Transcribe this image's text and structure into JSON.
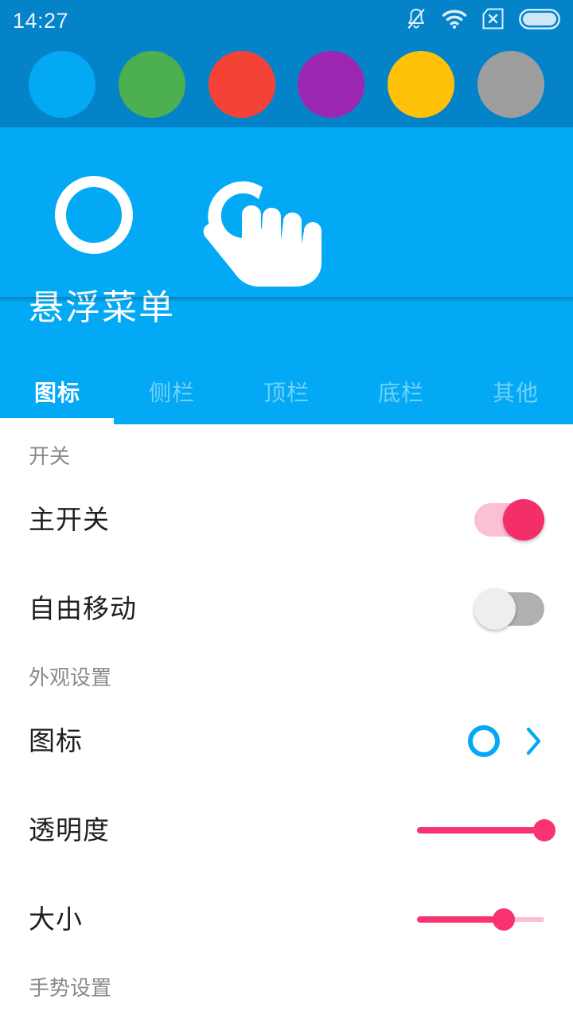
{
  "status_bar": {
    "time": "14:27",
    "icons": [
      {
        "name": "bell-muted-icon"
      },
      {
        "name": "wifi-icon"
      },
      {
        "name": "sim-disabled-icon"
      },
      {
        "name": "battery-icon"
      }
    ]
  },
  "color_palette": {
    "name": "color-swatch-strip",
    "background": "#0583c9",
    "swatches": [
      {
        "name": "swatch-blue",
        "color": "#03a9f4"
      },
      {
        "name": "swatch-green",
        "color": "#4caf50"
      },
      {
        "name": "swatch-red",
        "color": "#f44336"
      },
      {
        "name": "swatch-purple",
        "color": "#9c27b0"
      },
      {
        "name": "swatch-yellow",
        "color": "#ffc107"
      },
      {
        "name": "swatch-gray",
        "color": "#9e9e9e"
      }
    ]
  },
  "header": {
    "background": "#03a9f4",
    "title": "悬浮菜单",
    "art": {
      "ring_icon": "circle-ring-icon",
      "gesture_icon": "tap-gesture-hand-icon"
    }
  },
  "tabs": {
    "active_index": 0,
    "items": [
      {
        "label": "图标"
      },
      {
        "label": "侧栏"
      },
      {
        "label": "顶栏"
      },
      {
        "label": "底栏"
      },
      {
        "label": "其他"
      }
    ]
  },
  "sections": [
    {
      "title": "开关",
      "rows": [
        {
          "label": "主开关",
          "control": "toggle",
          "state": "on"
        },
        {
          "label": "自由移动",
          "control": "toggle",
          "state": "off"
        }
      ]
    },
    {
      "title": "外观设置",
      "rows": [
        {
          "label": "图标",
          "control": "chevron",
          "preview": "circle-ring-icon"
        },
        {
          "label": "透明度",
          "control": "slider",
          "value": 100
        },
        {
          "label": "大小",
          "control": "slider",
          "value": 68
        }
      ]
    },
    {
      "title": "手势设置",
      "rows": []
    }
  ],
  "colors": {
    "status_bar_bg": "#0583c9",
    "header_bg": "#03a9f4",
    "accent_pink": "#f8336f",
    "accent_pink_light": "#fbc0d3",
    "accent_blue": "#03a9f4",
    "toggle_off_track": "#b0b0b0",
    "section_title": "#8a8a8a",
    "row_label": "#1f1f1f"
  }
}
